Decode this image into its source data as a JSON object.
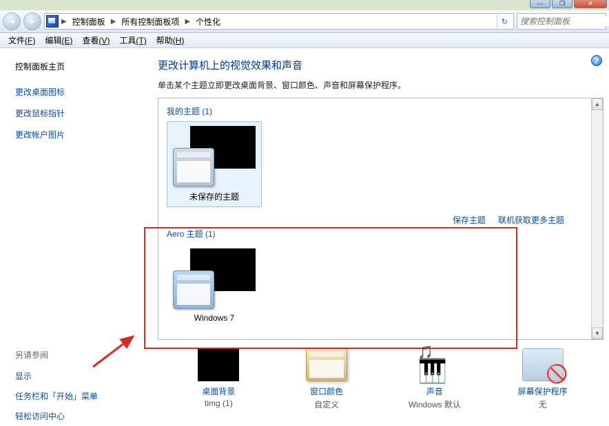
{
  "window_controls": {
    "min": "—",
    "max": "❐",
    "close": "✕"
  },
  "nav": {
    "back": "◄",
    "forward": "►",
    "refresh": "↻"
  },
  "breadcrumb": {
    "sep": "▶",
    "items": [
      "控制面板",
      "所有控制面板项",
      "个性化"
    ]
  },
  "search": {
    "placeholder": "搜索控制面板",
    "icon": "🔍"
  },
  "menubar": [
    {
      "label": "文件",
      "hotkey": "(F)"
    },
    {
      "label": "编辑",
      "hotkey": "(E)"
    },
    {
      "label": "查看",
      "hotkey": "(V)"
    },
    {
      "label": "工具",
      "hotkey": "(T)"
    },
    {
      "label": "帮助",
      "hotkey": "(H)"
    }
  ],
  "sidebar": {
    "home": "控制面板主页",
    "links": [
      "更改桌面图标",
      "更改鼠标指针",
      "更改帐户图片"
    ],
    "seealso_label": "另请参阅",
    "seealso": [
      "显示",
      "任务栏和「开始」菜单",
      "轻松访问中心"
    ]
  },
  "main": {
    "heading": "更改计算机上的视觉效果和声音",
    "subtext": "单击某个主题立即更改桌面背景、窗口颜色、声音和屏幕保护程序。",
    "help": "?",
    "sections": {
      "my": {
        "label": "我的主题 (1)",
        "item_label": "未保存的主题"
      },
      "aero": {
        "label": "Aero 主题 (1)",
        "item_label": "Windows 7"
      }
    },
    "links": {
      "save": "保存主题",
      "more": "联机获取更多主题"
    }
  },
  "settings": [
    {
      "title": "桌面背景",
      "value": "timg (1)"
    },
    {
      "title": "窗口颜色",
      "value": "自定义"
    },
    {
      "title": "声音",
      "value": "Windows 默认"
    },
    {
      "title": "屏幕保护程序",
      "value": "无"
    }
  ],
  "scroll": {
    "up": "▲",
    "down": "▼"
  }
}
